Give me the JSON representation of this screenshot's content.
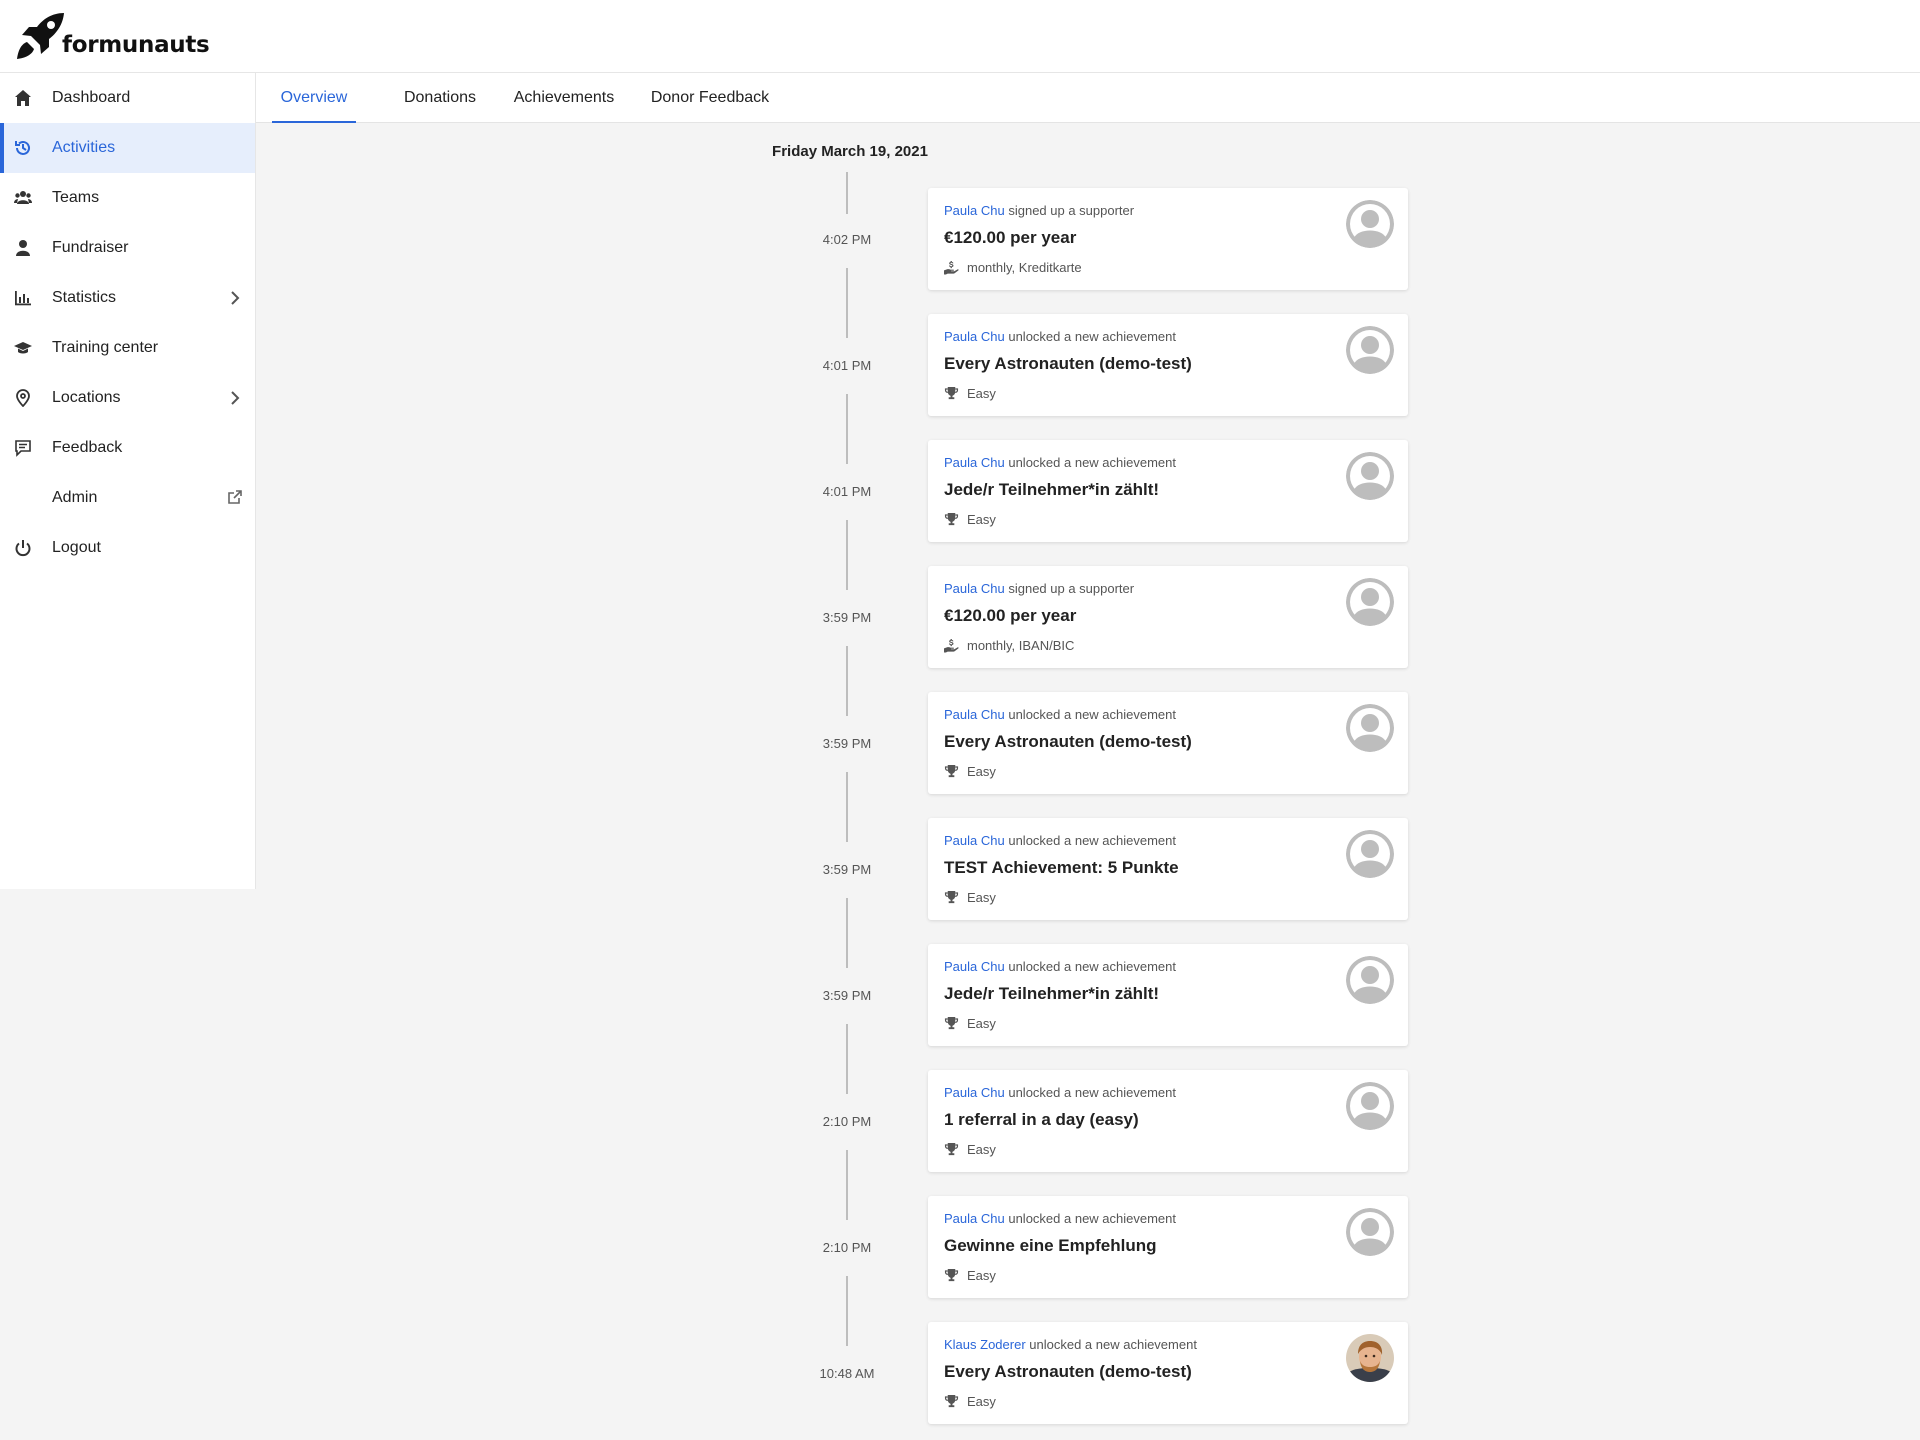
{
  "brand": {
    "name": "formunauts"
  },
  "sidebar": {
    "items": [
      {
        "label": "Dashboard",
        "icon": "home-icon"
      },
      {
        "label": "Activities",
        "icon": "history-icon"
      },
      {
        "label": "Teams",
        "icon": "users-icon"
      },
      {
        "label": "Fundraiser",
        "icon": "user-icon"
      },
      {
        "label": "Statistics",
        "icon": "bar-chart-icon"
      },
      {
        "label": "Training center",
        "icon": "graduation-cap-icon"
      },
      {
        "label": "Locations",
        "icon": "map-pin-icon"
      },
      {
        "label": "Feedback",
        "icon": "message-icon"
      },
      {
        "label": "Admin",
        "icon": "external-link-icon"
      },
      {
        "label": "Logout",
        "icon": "power-icon"
      }
    ]
  },
  "tabs": [
    {
      "label": "Overview"
    },
    {
      "label": "Donations"
    },
    {
      "label": "Achievements"
    },
    {
      "label": "Donor Feedback"
    }
  ],
  "timeline": {
    "date": "Friday March 19, 2021",
    "entries": [
      {
        "time": "4:02 PM",
        "actor": "Paula Chu",
        "action": "signed up a supporter",
        "title": "€120.00 per year",
        "meta": "monthly, Kreditkarte",
        "meta_icon": "hand-money-icon",
        "avatar": "placeholder-avatar-icon"
      },
      {
        "time": "4:01 PM",
        "actor": "Paula Chu",
        "action": "unlocked a new achievement",
        "title": "Every Astronauten (demo-test)",
        "meta": "Easy",
        "meta_icon": "trophy-icon",
        "avatar": "placeholder-avatar-icon"
      },
      {
        "time": "4:01 PM",
        "actor": "Paula Chu",
        "action": "unlocked a new achievement",
        "title": "Jede/r Teilnehmer*in zählt!",
        "meta": "Easy",
        "meta_icon": "trophy-icon",
        "avatar": "placeholder-avatar-icon"
      },
      {
        "time": "3:59 PM",
        "actor": "Paula Chu",
        "action": "signed up a supporter",
        "title": "€120.00 per year",
        "meta": "monthly, IBAN/BIC",
        "meta_icon": "hand-money-icon",
        "avatar": "placeholder-avatar-icon"
      },
      {
        "time": "3:59 PM",
        "actor": "Paula Chu",
        "action": "unlocked a new achievement",
        "title": "Every Astronauten (demo-test)",
        "meta": "Easy",
        "meta_icon": "trophy-icon",
        "avatar": "placeholder-avatar-icon"
      },
      {
        "time": "3:59 PM",
        "actor": "Paula Chu",
        "action": "unlocked a new achievement",
        "title": "TEST Achievement: 5 Punkte",
        "meta": "Easy",
        "meta_icon": "trophy-icon",
        "avatar": "placeholder-avatar-icon"
      },
      {
        "time": "3:59 PM",
        "actor": "Paula Chu",
        "action": "unlocked a new achievement",
        "title": "Jede/r Teilnehmer*in zählt!",
        "meta": "Easy",
        "meta_icon": "trophy-icon",
        "avatar": "placeholder-avatar-icon"
      },
      {
        "time": "2:10 PM",
        "actor": "Paula Chu",
        "action": "unlocked a new achievement",
        "title": "1 referral in a day (easy)",
        "meta": "Easy",
        "meta_icon": "trophy-icon",
        "avatar": "placeholder-avatar-icon"
      },
      {
        "time": "2:10 PM",
        "actor": "Paula Chu",
        "action": "unlocked a new achievement",
        "title": "Gewinne eine Empfehlung",
        "meta": "Easy",
        "meta_icon": "trophy-icon",
        "avatar": "placeholder-avatar-icon"
      },
      {
        "time": "10:48 AM",
        "actor": "Klaus Zoderer",
        "action": "unlocked a new achievement",
        "title": "Every Astronauten (demo-test)",
        "meta": "Easy",
        "meta_icon": "trophy-icon",
        "avatar": "user-photo-avatar"
      }
    ]
  },
  "colors": {
    "accent": "#2a66d9",
    "active_bg": "#e6eefc",
    "page_bg": "#f4f4f4"
  }
}
